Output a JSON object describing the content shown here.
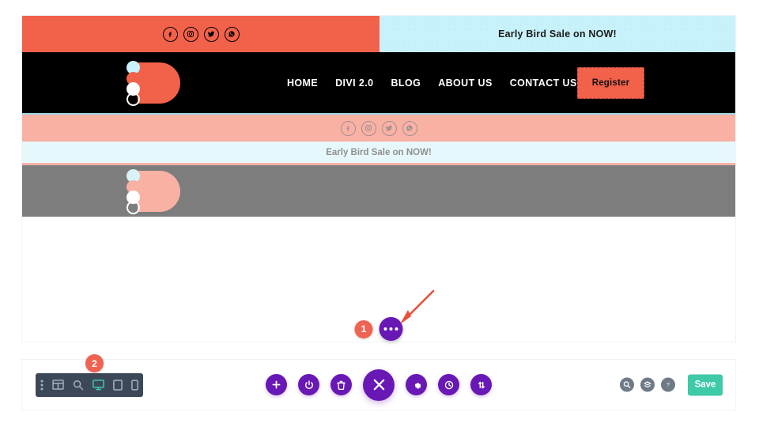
{
  "preview": {
    "utility_bar": {
      "social_icons": [
        {
          "name": "facebook-icon",
          "label": "Facebook"
        },
        {
          "name": "instagram-icon",
          "label": "Instagram"
        },
        {
          "name": "twitter-icon",
          "label": "Twitter"
        },
        {
          "name": "whatsapp-icon",
          "label": "WhatsApp"
        }
      ],
      "promo_text": "Early Bird Sale on NOW!",
      "left_bg": "#f2614a",
      "right_bg": "#c8f2fb"
    },
    "main_nav": {
      "logo_alt": "Divi D logo",
      "menu": [
        {
          "label": "HOME"
        },
        {
          "label": "DIVI 2.0"
        },
        {
          "label": "BLOG"
        },
        {
          "label": "ABOUT US"
        },
        {
          "label": "CONTACT US"
        }
      ],
      "cta_label": "Register",
      "bg": "#000000",
      "accent": "#f2614a"
    },
    "ghost_row": {
      "promo_text": "Early Bird Sale on NOW!",
      "social_bg": "#f9b1a4",
      "promo_bg": "#e7f8fc",
      "nav_bg": "#7d7d7d"
    },
    "insert_control": {
      "step_number": "1",
      "button_name": "row-options-ellipsis",
      "accent": "#6818b4",
      "badge_color": "#ef6352"
    }
  },
  "builder_bar": {
    "badge_number": "2",
    "device_toolbar": {
      "items": [
        {
          "name": "grip-dots-icon",
          "label": "Drag handle",
          "active": false
        },
        {
          "name": "wireframe-icon",
          "label": "Wireframe view",
          "active": false
        },
        {
          "name": "zoom-out-icon",
          "label": "Zoom out view",
          "active": false
        },
        {
          "name": "desktop-icon",
          "label": "Desktop view",
          "active": true
        },
        {
          "name": "tablet-icon",
          "label": "Tablet view",
          "active": false
        },
        {
          "name": "mobile-icon",
          "label": "Phone view",
          "active": false
        }
      ],
      "bg": "#3c4858",
      "active_color": "#3ec9a7"
    },
    "center_actions": [
      {
        "name": "add-section-button",
        "label": "Add new section",
        "size": "small"
      },
      {
        "name": "toggle-builder-button",
        "label": "Disable builder",
        "size": "small"
      },
      {
        "name": "clear-layout-button",
        "label": "Clear layout",
        "size": "small"
      },
      {
        "name": "close-builder-button",
        "label": "Close builder menu",
        "size": "large"
      },
      {
        "name": "builder-settings-button",
        "label": "Builder settings",
        "size": "small"
      },
      {
        "name": "editing-history-button",
        "label": "Editing history",
        "size": "small"
      },
      {
        "name": "portability-button",
        "label": "Portability",
        "size": "small"
      }
    ],
    "right_actions": [
      {
        "name": "search-icon",
        "label": "Search"
      },
      {
        "name": "layers-icon",
        "label": "Layers"
      },
      {
        "name": "help-icon",
        "label": "Help"
      }
    ],
    "save_label": "Save",
    "save_color": "#3ec9a7"
  }
}
